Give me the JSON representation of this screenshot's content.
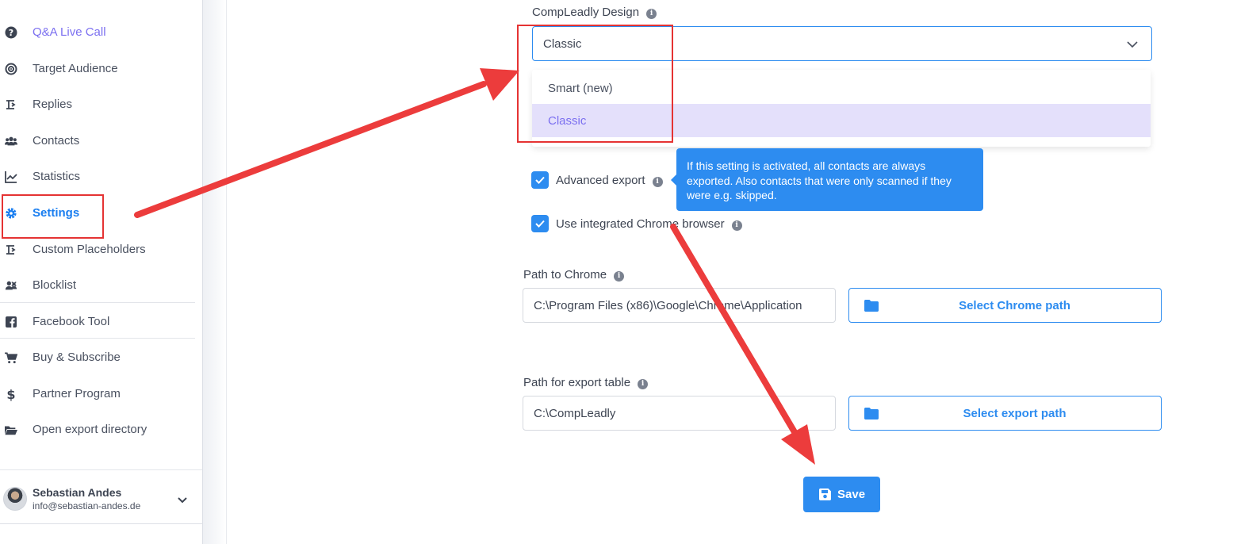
{
  "sidebar": {
    "items": [
      {
        "label": "Q&A Live Call",
        "icon": "question-circle-icon"
      },
      {
        "label": "Target Audience",
        "icon": "target-icon"
      },
      {
        "label": "Replies",
        "icon": "replies-icon"
      },
      {
        "label": "Contacts",
        "icon": "users-icon"
      },
      {
        "label": "Statistics",
        "icon": "chart-line-icon"
      },
      {
        "label": "Settings",
        "icon": "gear-icon"
      },
      {
        "label": "Custom Placeholders",
        "icon": "placeholder-icon"
      },
      {
        "label": "Blocklist",
        "icon": "blocked-users-icon"
      },
      {
        "label": "Facebook Tool",
        "icon": "facebook-icon"
      },
      {
        "label": "Buy & Subscribe",
        "icon": "cart-icon"
      },
      {
        "label": "Partner Program",
        "icon": "dollar-icon"
      },
      {
        "label": "Open export directory",
        "icon": "folder-open-icon"
      }
    ],
    "user": {
      "name": "Sebastian Andes",
      "email": "info@sebastian-andes.de"
    }
  },
  "settings": {
    "design": {
      "label": "CompLeadly Design",
      "value": "Classic",
      "options": [
        "Smart (new)",
        "Classic"
      ]
    },
    "advanced_export": {
      "label": "Advanced export",
      "checked": true,
      "tooltip": "If this setting is activated, all contacts are always exported. Also contacts that were only scanned if they were e.g. skipped."
    },
    "chrome_browser": {
      "label": "Use integrated Chrome browser",
      "checked": true
    },
    "chrome_path": {
      "label": "Path to Chrome",
      "value": "C:\\Program Files (x86)\\Google\\Chrome\\Application",
      "button": "Select Chrome path"
    },
    "export_path": {
      "label": "Path for export table",
      "value": "C:\\CompLeadly",
      "button": "Select export path"
    },
    "save_label": "Save"
  },
  "colors": {
    "accent": "#2d8cf0",
    "highlight": "#e53333",
    "selected_option": "#e4e0fb"
  }
}
